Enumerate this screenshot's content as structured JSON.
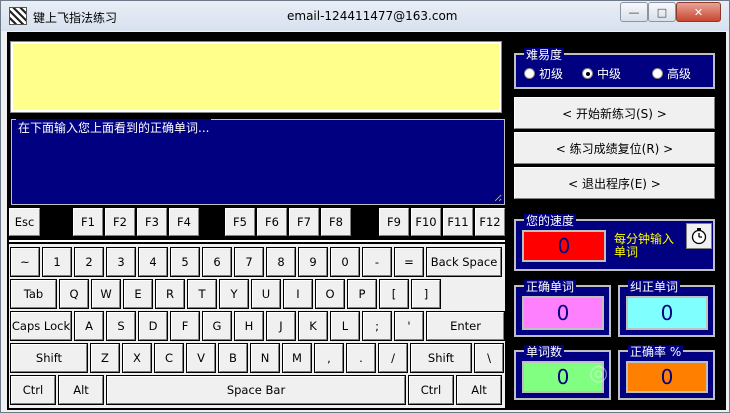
{
  "window": {
    "title": "键上飞指法练习",
    "email": "email-124411477@163.com",
    "controls": {
      "minimize": "—",
      "maximize": "□",
      "close": "✕"
    }
  },
  "input_area": {
    "label": "在下面输入您上面看到的正确单词...",
    "value": ""
  },
  "keyboard": {
    "function_row": [
      "Esc",
      "F1",
      "F2",
      "F3",
      "F4",
      "F5",
      "F6",
      "F7",
      "F8",
      "F9",
      "F10",
      "F11",
      "F12"
    ],
    "row1": [
      "~",
      "1",
      "2",
      "3",
      "4",
      "5",
      "6",
      "7",
      "8",
      "9",
      "0",
      "-",
      "=",
      "Back Space"
    ],
    "row2": [
      "Tab",
      "Q",
      "W",
      "E",
      "R",
      "T",
      "Y",
      "U",
      "I",
      "O",
      "P",
      "[",
      "]"
    ],
    "row3": [
      "Caps Lock",
      "A",
      "S",
      "D",
      "F",
      "G",
      "H",
      "J",
      "K",
      "L",
      ";",
      "'",
      "Enter"
    ],
    "row4": [
      "Shift",
      "Z",
      "X",
      "C",
      "V",
      "B",
      "N",
      "M",
      ",",
      ".",
      "/",
      "Shift",
      "\\"
    ],
    "row5": [
      "Ctrl",
      "Alt",
      "Space Bar",
      "Ctrl",
      "Alt"
    ]
  },
  "difficulty": {
    "title": "难易度",
    "options": [
      "初级",
      "中级",
      "高级"
    ],
    "selected": "中级"
  },
  "buttons": {
    "start": "< 开始新练习(S) >",
    "reset": "< 练习成绩复位(R) >",
    "exit": "< 退出程序(E) >"
  },
  "stats": {
    "speed_title": "您的速度",
    "speed_value": "0",
    "speed_unit": "每分钟输入单词",
    "correct_title": "正确单词",
    "correct_value": "0",
    "fixed_title": "纠正单词",
    "fixed_value": "0",
    "count_title": "单词数",
    "count_value": "0",
    "rate_title": "正确率 %",
    "rate_value": "0"
  },
  "colors": {
    "display_bg": "#ffff8c",
    "panel_bg": "#000080",
    "speed_box": "#ff0000",
    "correct_box": "#ff80ff",
    "fixed_box": "#80ffff",
    "count_box": "#80ff80",
    "rate_box": "#ff8000"
  },
  "icons": {
    "timer": "stopwatch-icon",
    "app": "app-icon"
  }
}
